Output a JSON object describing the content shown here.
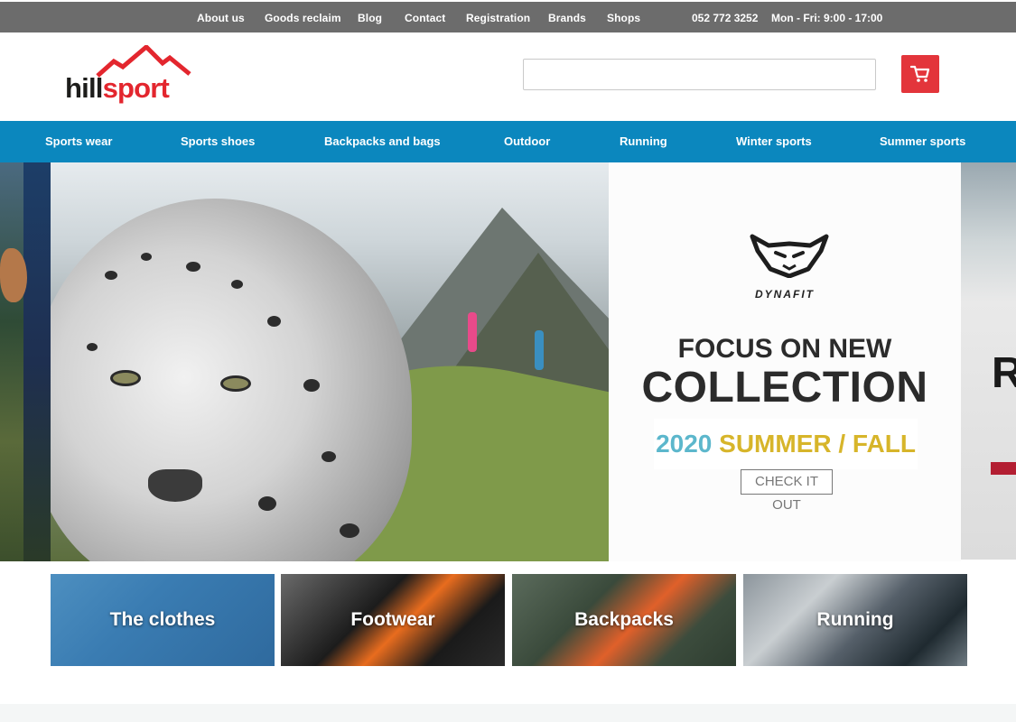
{
  "topbar": {
    "links": [
      "About us",
      "Goods reclaim",
      "Blog",
      "Contact",
      "Registration",
      "Brands",
      "Shops"
    ],
    "phone": "052 772 3252",
    "hours": "Mon - Fri:  9:00 - 17:00"
  },
  "header": {
    "logo": {
      "part1": "hill",
      "part2": "sport"
    },
    "search": {
      "value": "",
      "placeholder": ""
    },
    "cart_icon": "shopping-cart-icon"
  },
  "nav": {
    "items": [
      "Sports wear",
      "Sports shoes",
      "Backpacks and bags",
      "Outdoor",
      "Running",
      "Winter sports",
      "Summer sports"
    ]
  },
  "hero": {
    "brand": "DYNAFIT",
    "headline1": "FOCUS ON NEW",
    "headline2": "COLLECTION",
    "season_year": "2020",
    "season_name": "SUMMER / FALL",
    "cta": "CHECK IT OUT",
    "next_peek_letter": "R"
  },
  "categories": [
    "The clothes",
    "Footwear",
    "Backpacks",
    "Running"
  ],
  "colors": {
    "topbar": "#6c6c6c",
    "nav": "#0b87be",
    "brand_red": "#e3262e",
    "season_year": "#5cb7cc",
    "season_name": "#d7b52a"
  }
}
